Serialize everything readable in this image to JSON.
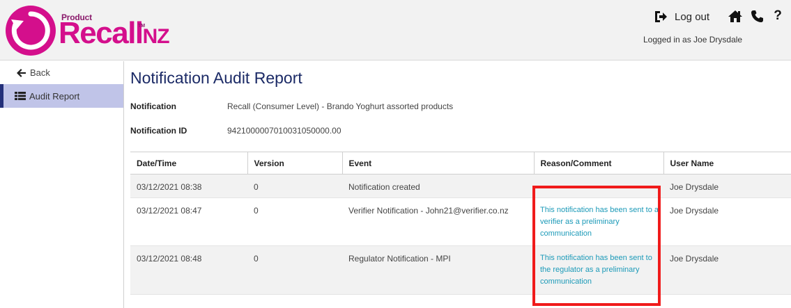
{
  "header": {
    "logo": {
      "product": "Product",
      "recall": "Recall",
      "nz": "NZ",
      "tm": "TM"
    },
    "logout_label": "Log out",
    "logged_in_text": "Logged in as Joe Drysdale",
    "help_glyph": "?",
    "icons": [
      "logout-icon",
      "home-icon",
      "phone-icon",
      "help-icon"
    ]
  },
  "sidebar": {
    "back_label": "Back",
    "items": [
      {
        "label": "Audit Report",
        "icon": "list-icon",
        "active": true
      }
    ]
  },
  "page": {
    "title": "Notification Audit Report",
    "notification_label": "Notification",
    "notification_value": "Recall (Consumer Level) - Brando Yoghurt assorted products",
    "notification_id_label": "Notification ID",
    "notification_id_value": "9421000007010031050000.00"
  },
  "table": {
    "columns": [
      "Date/Time",
      "Version",
      "Event",
      "Reason/Comment",
      "User Name"
    ],
    "rows": [
      {
        "datetime": "03/12/2021 08:38",
        "version": "0",
        "event": "Notification created",
        "comment": "",
        "user": "Joe Drysdale"
      },
      {
        "datetime": "03/12/2021 08:47",
        "version": "0",
        "event": "Verifier Notification - John21@verifier.co.nz",
        "comment": "This notification has been sent to a verifier as a preliminary communication",
        "user": "Joe Drysdale"
      },
      {
        "datetime": "03/12/2021 08:48",
        "version": "0",
        "event": "Regulator Notification - MPI",
        "comment": "This notification has been sent to the regulator as a preliminary communication",
        "user": "Joe Drysdale"
      }
    ]
  },
  "colors": {
    "brand_magenta": "#d40f8c",
    "title_navy": "#1b2a66",
    "sidebar_active_bg": "#c0c4e8",
    "sidebar_active_bar": "#23307a",
    "comment_teal": "#1c9ab8",
    "highlight_red": "#f01b1b"
  }
}
